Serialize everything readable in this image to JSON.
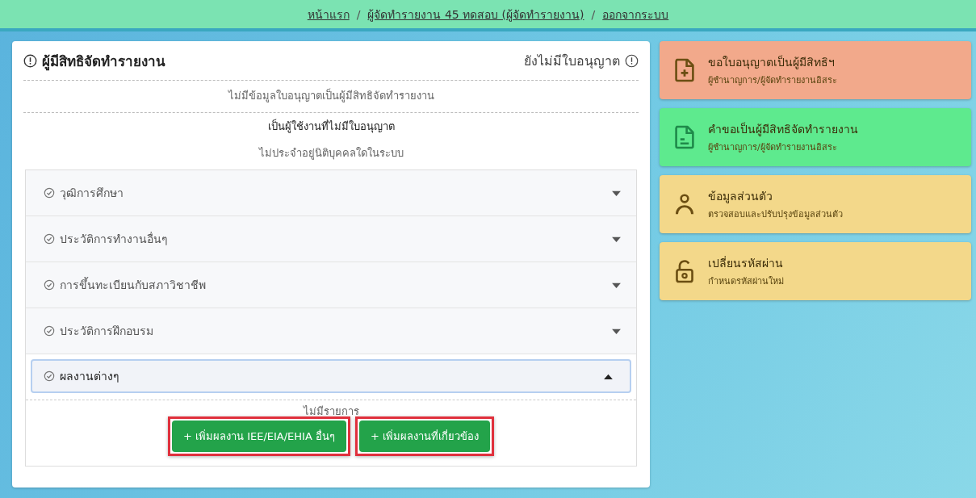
{
  "breadcrumb": [
    {
      "label": "หน้าแรก"
    },
    {
      "separator": "/",
      "label": "ผู้จัดทำรายงาน 45 ทดสอบ (ผู้จัดทำรายงาน)"
    },
    {
      "separator": "/",
      "label": "ออกจากระบบ"
    }
  ],
  "license_card": {
    "title": "ผู้มีสิทธิจัดทำรายงาน",
    "status": "ยังไม่มีใบอนุญาต",
    "no_data": "ไม่มีข้อมูลใบอนุญาตเป็นผู้มีสิทธิจัดทำรายงาน",
    "user_type": "เป็นผู้ใช้งานที่ไม่มีใบอนุญาต",
    "affiliation": "ไม่ประจำอยู่นิติบุคคลใดในระบบ",
    "sections": [
      {
        "label": "วุฒิการศึกษา",
        "expanded": false
      },
      {
        "label": "ประวัติการทำงานอื่นๆ",
        "expanded": false
      },
      {
        "label": "การขึ้นทะเบียนกับสภาวิชาชีพ",
        "expanded": false
      },
      {
        "label": "ประวัติการฝึกอบรม",
        "expanded": false
      },
      {
        "label": "ผลงานต่างๆ",
        "expanded": true,
        "empty_text": "ไม่มีรายการ",
        "buttons": [
          {
            "label": "+ เพิ่มผลงาน IEE/EIA/EHIA อื่นๆ",
            "highlighted": true
          },
          {
            "label": "+ เพิ่มผลงานที่เกี่ยวข้อง",
            "highlighted": true
          }
        ]
      }
    ]
  },
  "menu_cards": [
    {
      "kind": "add-doc",
      "title": "ขอใบอนุญาตเป็นผู้มีสิทธิฯ",
      "subtitle": "ผู้ชำนาญการ/ผู้จัดทำรายงานอิสระ",
      "color": "#f2a98b"
    },
    {
      "kind": "doc",
      "title": "คำขอเป็นผู้มีสิทธิจัดทำรายงาน",
      "subtitle": "ผู้ชำนาญการ/ผู้จัดทำรายงานอิสระ",
      "color": "#5eea8e"
    },
    {
      "kind": "person",
      "title": "ข้อมูลส่วนตัว",
      "subtitle": "ตรวจสอบและปรับปรุงข้อมูลส่วนตัว",
      "color": "#f3d88a"
    },
    {
      "kind": "lock",
      "title": "เปลี่ยนรหัสผ่าน",
      "subtitle": "กำหนดรหัสผ่านใหม่",
      "color": "#f3d88a"
    }
  ]
}
